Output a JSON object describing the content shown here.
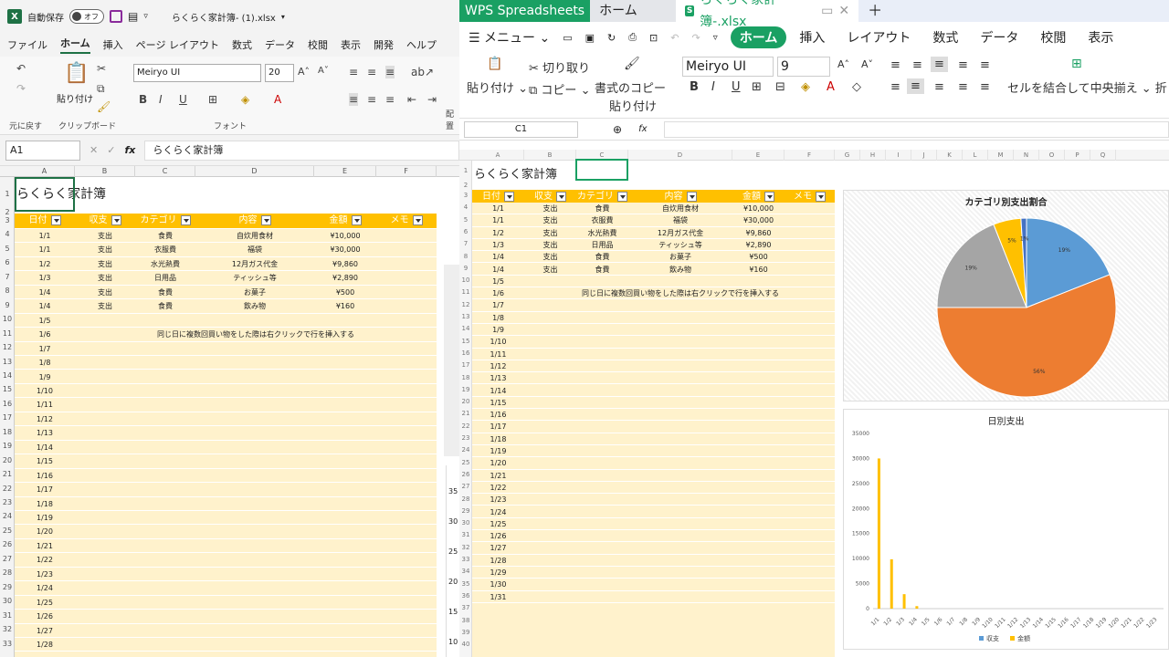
{
  "excel": {
    "autosave_label": "自動保存",
    "toggle_label": "オフ",
    "file_title": "らくらく家計簿- (1).xlsx",
    "menu": [
      "ファイル",
      "ホーム",
      "挿入",
      "ページ レイアウト",
      "数式",
      "データ",
      "校閲",
      "表示",
      "開発",
      "ヘルプ"
    ],
    "ribbon": {
      "paste": "貼り付け",
      "undo_group": "元に戻す",
      "clipboard_group": "クリップボード",
      "font_group": "フォント",
      "align_group": "配置",
      "font_name": "Meiryo UI",
      "font_size": "20"
    },
    "name_box": "A1",
    "fx_label": "fx",
    "formula": "らくらく家計簿",
    "columns": [
      "A",
      "B",
      "C",
      "D",
      "E",
      "F"
    ],
    "rows": [
      "1",
      "2",
      "3",
      "4",
      "5",
      "6",
      "7",
      "8",
      "9",
      "10",
      "11",
      "12",
      "13",
      "14",
      "15",
      "16",
      "17",
      "18",
      "19",
      "20",
      "21",
      "22",
      "23",
      "24",
      "25",
      "26",
      "27",
      "28",
      "29",
      "30",
      "31",
      "32",
      "33"
    ],
    "sheet_title": "らくらく家計簿",
    "header": [
      "日付",
      "収支",
      "カテゴリ",
      "内容",
      "金額",
      "メモ"
    ],
    "data_rows": [
      [
        "1/1",
        "支出",
        "食費",
        "自炊用食材",
        "¥10,000",
        ""
      ],
      [
        "1/1",
        "支出",
        "衣服費",
        "福袋",
        "¥30,000",
        ""
      ],
      [
        "1/2",
        "支出",
        "水光熱費",
        "12月ガス代金",
        "¥9,860",
        ""
      ],
      [
        "1/3",
        "支出",
        "日用品",
        "ティッシュ等",
        "¥2,890",
        ""
      ],
      [
        "1/4",
        "支出",
        "食費",
        "お菓子",
        "¥500",
        ""
      ],
      [
        "1/4",
        "支出",
        "食費",
        "飲み物",
        "¥160",
        ""
      ]
    ],
    "dates": [
      "1/5",
      "1/6",
      "1/7",
      "1/8",
      "1/9",
      "1/10",
      "1/11",
      "1/12",
      "1/13",
      "1/14",
      "1/15",
      "1/16",
      "1/17",
      "1/18",
      "1/19",
      "1/20",
      "1/21",
      "1/22",
      "1/23",
      "1/24",
      "1/25",
      "1/26",
      "1/27",
      "1/28"
    ],
    "note": "同じ日に複数回買い物をした際は右クリックで行を挿入する",
    "peek_labels": [
      "35",
      "30",
      "25",
      "20",
      "15",
      "10"
    ]
  },
  "wps": {
    "tabs": {
      "app": "WPS Spreadsheets",
      "home": "ホーム",
      "file": "らくらく家計簿-.xlsx"
    },
    "menu": [
      "メニュー",
      "ホーム",
      "挿入",
      "レイアウト",
      "数式",
      "データ",
      "校閲",
      "表示"
    ],
    "ribbon": {
      "paste": "貼り付け",
      "cut": "切り取り",
      "copy": "コピー",
      "format_copy": "書式のコピー",
      "format_paste": "貼り付け",
      "font_name": "Meiryo UI",
      "font_size": "9",
      "merge": "セルを結合して中央揃え",
      "wrap": "折"
    },
    "name_box": "C1",
    "fx_label": "fx",
    "columns": [
      "A",
      "B",
      "C",
      "D",
      "E",
      "F",
      "G",
      "H",
      "I",
      "J",
      "K",
      "L",
      "M",
      "N",
      "O",
      "P",
      "Q"
    ],
    "rows": [
      "1",
      "2",
      "3",
      "4",
      "5",
      "6",
      "7",
      "8",
      "9",
      "10",
      "11",
      "12",
      "13",
      "14",
      "15",
      "16",
      "17",
      "18",
      "19",
      "20",
      "21",
      "22",
      "23",
      "24",
      "25",
      "26",
      "27",
      "28",
      "29",
      "30",
      "31",
      "32",
      "33",
      "34",
      "35",
      "36",
      "37",
      "38",
      "39",
      "40"
    ],
    "sheet_title": "らくらく家計簿",
    "header": [
      "日付",
      "収支",
      "カテゴリ",
      "内容",
      "金額",
      "メモ"
    ],
    "data_rows": [
      [
        "1/1",
        "支出",
        "食費",
        "自炊用食材",
        "¥10,000",
        ""
      ],
      [
        "1/1",
        "支出",
        "衣服費",
        "福袋",
        "¥30,000",
        ""
      ],
      [
        "1/2",
        "支出",
        "水光熱費",
        "12月ガス代金",
        "¥9,860",
        ""
      ],
      [
        "1/3",
        "支出",
        "日用品",
        "ティッシュ等",
        "¥2,890",
        ""
      ],
      [
        "1/4",
        "支出",
        "食費",
        "お菓子",
        "¥500",
        ""
      ],
      [
        "1/4",
        "支出",
        "食費",
        "飲み物",
        "¥160",
        ""
      ]
    ],
    "dates": [
      "1/5",
      "1/6",
      "1/7",
      "1/8",
      "1/9",
      "1/10",
      "1/11",
      "1/12",
      "1/13",
      "1/14",
      "1/15",
      "1/16",
      "1/17",
      "1/18",
      "1/19",
      "1/20",
      "1/21",
      "1/22",
      "1/23",
      "1/24",
      "1/25",
      "1/26",
      "1/27",
      "1/28",
      "1/29",
      "1/30",
      "1/31"
    ],
    "note": "同じ日に複数回買い物をした際は右クリックで行を挿入する"
  },
  "colors": {
    "accent_green": "#1aa063",
    "header_gold": "#ffc000",
    "row_fill": "#fff2cc",
    "excel_green": "#1e7145"
  },
  "chart_data": [
    {
      "type": "pie",
      "title": "カテゴリ別支出割合",
      "slices": [
        {
          "value": 19,
          "label": "19%",
          "color": "#5b9bd5"
        },
        {
          "value": 56,
          "label": "56%",
          "color": "#ed7d31"
        },
        {
          "value": 19,
          "label": "19%",
          "color": "#a5a5a5"
        },
        {
          "value": 5,
          "label": "5%",
          "color": "#ffc000"
        },
        {
          "value": 1,
          "label": "1%",
          "color": "#4472c4"
        }
      ]
    },
    {
      "type": "bar",
      "title": "日別支出",
      "categories": [
        "1/1",
        "1/2",
        "1/3",
        "1/4",
        "1/5",
        "1/6",
        "1/7",
        "1/8",
        "1/9",
        "1/10",
        "1/11",
        "1/12",
        "1/13",
        "1/14",
        "1/15",
        "1/16",
        "1/17",
        "1/18",
        "1/19",
        "1/20",
        "1/21",
        "1/22",
        "1/23"
      ],
      "series": [
        {
          "name": "収支",
          "color": "#5b9bd5",
          "values": [
            0,
            0,
            0,
            0,
            0,
            0,
            0,
            0,
            0,
            0,
            0,
            0,
            0,
            0,
            0,
            0,
            0,
            0,
            0,
            0,
            0,
            0,
            0
          ]
        },
        {
          "name": "金額",
          "color": "#ffc000",
          "values": [
            30000,
            9860,
            2890,
            500,
            0,
            0,
            0,
            0,
            0,
            0,
            0,
            0,
            0,
            0,
            0,
            0,
            0,
            0,
            0,
            0,
            0,
            0,
            0
          ]
        }
      ],
      "yticks": [
        "0",
        "5000",
        "10000",
        "15000",
        "20000",
        "25000",
        "30000",
        "35000"
      ],
      "ylim": [
        0,
        35000
      ],
      "legend": "bottom"
    }
  ]
}
